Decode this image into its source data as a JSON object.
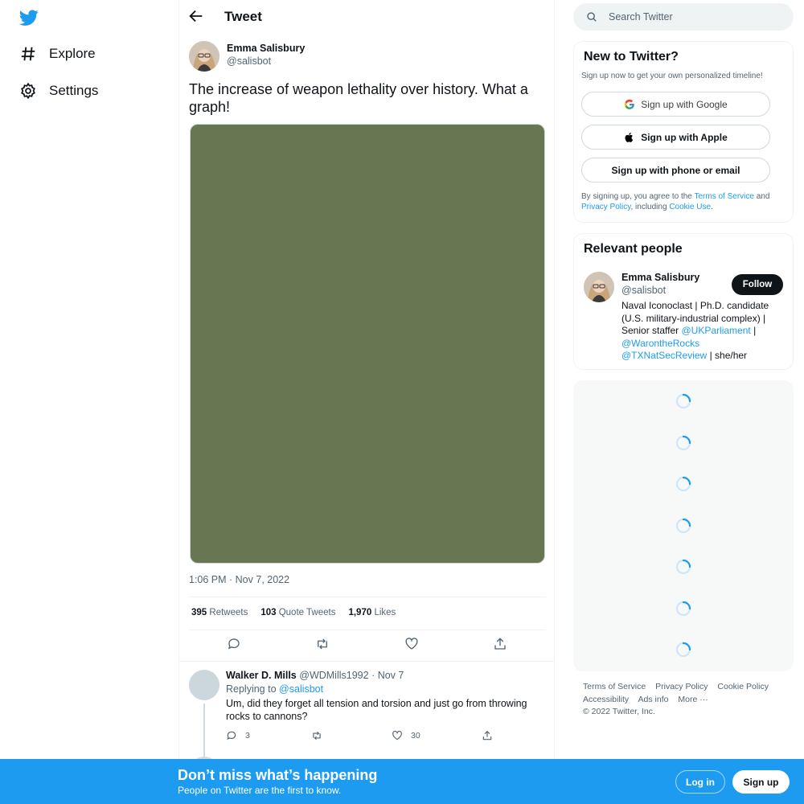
{
  "nav": {
    "logo": "twitter-bird-icon",
    "items": [
      {
        "label": "Explore",
        "icon": "hashtag-icon"
      },
      {
        "label": "Settings",
        "icon": "gear-icon"
      }
    ]
  },
  "header": {
    "title": "Tweet"
  },
  "tweet": {
    "author": {
      "name": "Emma Salisbury",
      "handle": "@salisbot"
    },
    "text": "The increase of weapon lethality over history. What a graph!",
    "timestamp": "1:06 PM · Nov 7, 2022",
    "stats": {
      "retweets_count": "395",
      "retweets_label": "Retweets",
      "quotes_count": "103",
      "quotes_label": "Quote Tweets",
      "likes_count": "1,970",
      "likes_label": "Likes"
    },
    "media_color": "#687751"
  },
  "reply": {
    "name": "Walker D. Mills",
    "handle": "@WDMills1992",
    "date": "· Nov 7",
    "replying_prefix": "Replying to",
    "replying_to": "@salisbot",
    "text": "Um, did they forget all tension and torsion and just go from throwing rocks to cannons?",
    "reply_count": "3",
    "like_count": "30"
  },
  "search": {
    "placeholder": "Search Twitter"
  },
  "signup": {
    "title": "New to Twitter?",
    "subtitle": "Sign up now to get your own personalized timeline!",
    "google": "Sign up with Google",
    "apple": "Sign up with Apple",
    "phone": "Sign up with phone or email",
    "legal_1": "By signing up, you agree to the",
    "terms": "Terms of Service",
    "legal_2": "and",
    "privacy": "Privacy Policy",
    "legal_3": ", including",
    "cookie": "Cookie Use",
    "legal_4": "."
  },
  "people": {
    "title": "Relevant people",
    "name": "Emma Salisbury",
    "handle": "@salisbot",
    "follow": "Follow",
    "bio_1": "Naval Iconoclast | Ph.D. candidate (U.S. military-industrial complex) | Senior staffer",
    "bio_link_1": "@UKParliament",
    "bio_2": "|",
    "bio_link_2": "@WarontheRocks",
    "bio_link_3": "@TXNatSecReview",
    "bio_3": "| she/her"
  },
  "footer": {
    "terms": "Terms of Service",
    "privacy": "Privacy Policy",
    "cookie": "Cookie Policy",
    "accessibility": "Accessibility",
    "ads": "Ads info",
    "more": "More ···",
    "copyright": "© 2022 Twitter, Inc."
  },
  "bottom_bar": {
    "title": "Don’t miss what’s happening",
    "subtitle": "People on Twitter are the first to know.",
    "login": "Log in",
    "signup": "Sign up"
  },
  "colors": {
    "accent": "#1d9bf0",
    "text": "#0f1419",
    "secondary": "#536471"
  }
}
